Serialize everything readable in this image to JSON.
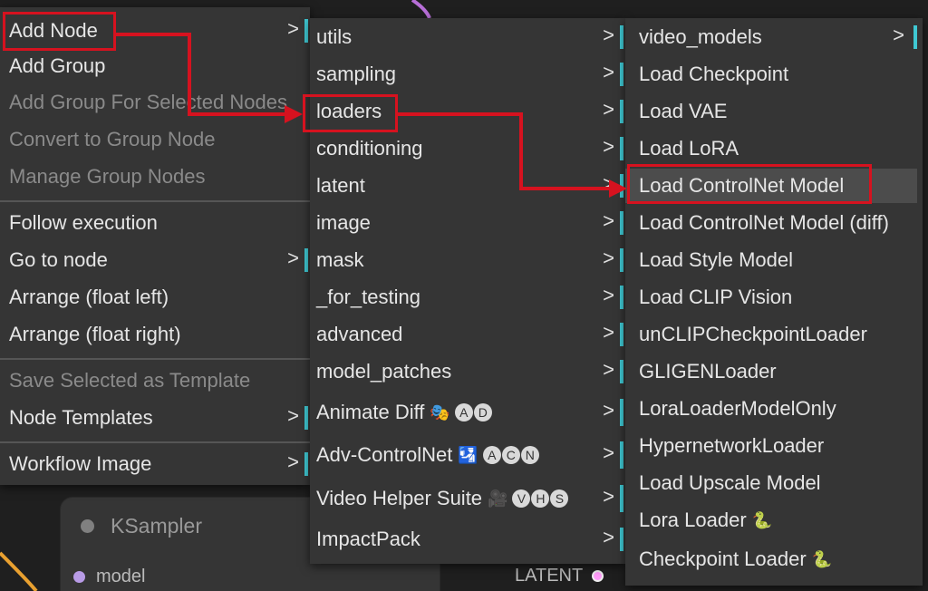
{
  "canvas": {
    "node": {
      "title": "KSampler",
      "input_label": "model",
      "output_label": "LATENT"
    }
  },
  "menu1": {
    "items": [
      {
        "label": "Add Node",
        "disabled": false,
        "submenu": true
      },
      {
        "label": "Add Group",
        "disabled": false,
        "submenu": false
      },
      {
        "label": "Add Group For Selected Nodes",
        "disabled": true,
        "submenu": false
      },
      {
        "label": "Convert to Group Node",
        "disabled": true,
        "submenu": false
      },
      {
        "label": "Manage Group Nodes",
        "disabled": true,
        "submenu": false
      },
      {
        "label": "Follow execution",
        "disabled": false,
        "submenu": false
      },
      {
        "label": "Go to node",
        "disabled": false,
        "submenu": true
      },
      {
        "label": "Arrange (float left)",
        "disabled": false,
        "submenu": false
      },
      {
        "label": "Arrange (float right)",
        "disabled": false,
        "submenu": false
      },
      {
        "label": "Save Selected as Template",
        "disabled": true,
        "submenu": false
      },
      {
        "label": "Node Templates",
        "disabled": false,
        "submenu": true
      },
      {
        "label": "Workflow Image",
        "disabled": false,
        "submenu": true
      }
    ]
  },
  "menu2": {
    "items": [
      {
        "label": "utils"
      },
      {
        "label": "sampling"
      },
      {
        "label": "loaders"
      },
      {
        "label": "conditioning"
      },
      {
        "label": "latent"
      },
      {
        "label": "image"
      },
      {
        "label": "mask"
      },
      {
        "label": "_for_testing"
      },
      {
        "label": "advanced"
      },
      {
        "label": "model_patches"
      },
      {
        "label": "Animate Diff",
        "emoji": "🎭",
        "badges": [
          "A",
          "D"
        ]
      },
      {
        "label": "Adv-ControlNet",
        "emoji": "🛂",
        "badges": [
          "A",
          "C",
          "N"
        ]
      },
      {
        "label": "Video Helper Suite",
        "emoji": "🎥",
        "badges": [
          "V",
          "H",
          "S"
        ]
      },
      {
        "label": "ImpactPack"
      }
    ]
  },
  "menu3": {
    "items": [
      {
        "label": "video_models",
        "submenu": true
      },
      {
        "label": "Load Checkpoint"
      },
      {
        "label": "Load VAE"
      },
      {
        "label": "Load LoRA"
      },
      {
        "label": "Load ControlNet Model",
        "selected": true
      },
      {
        "label": "Load ControlNet Model (diff)"
      },
      {
        "label": "Load Style Model"
      },
      {
        "label": "Load CLIP Vision"
      },
      {
        "label": "unCLIPCheckpointLoader"
      },
      {
        "label": "GLIGENLoader"
      },
      {
        "label": "LoraLoaderModelOnly"
      },
      {
        "label": "HypernetworkLoader"
      },
      {
        "label": "Load Upscale Model"
      },
      {
        "label": "Lora Loader",
        "emoji": "🐍"
      },
      {
        "label": "Checkpoint Loader",
        "emoji": "🐍"
      }
    ]
  },
  "chevron": ">",
  "colors": {
    "menu_bg": "#353535",
    "submenu_indicator": "#3fc8d3",
    "annotation_red": "#d6121f",
    "selected_bg": "#4c4c4c"
  }
}
